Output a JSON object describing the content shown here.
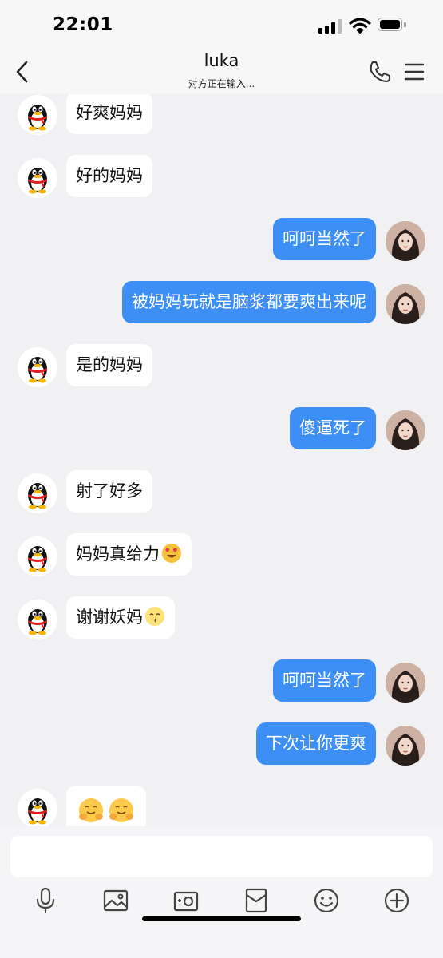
{
  "status_bar": {
    "time": "22:01"
  },
  "header": {
    "title": "luka",
    "subtitle": "对方正在输入..."
  },
  "messages": [
    {
      "side": "in",
      "text": "好爽妈妈"
    },
    {
      "side": "in",
      "text": "好的妈妈"
    },
    {
      "side": "out",
      "text": "呵呵当然了"
    },
    {
      "side": "out",
      "text": "被妈妈玩就是脑浆都要爽出来呢"
    },
    {
      "side": "in",
      "text": "是的妈妈"
    },
    {
      "side": "out",
      "text": "傻逼死了"
    },
    {
      "side": "in",
      "text": "射了好多"
    },
    {
      "side": "in",
      "text": "妈妈真给力",
      "emoji": "heart-eyes-emoji"
    },
    {
      "side": "in",
      "text": "谢谢妖妈",
      "emoji": "kissing-emoji"
    },
    {
      "side": "out",
      "text": "呵呵当然了"
    },
    {
      "side": "out",
      "text": "下次让你更爽"
    },
    {
      "side": "in",
      "text": "",
      "emoji": "shy-smile-emoji x2"
    }
  ],
  "toolbar": {
    "icons": [
      "microphone-icon",
      "photo-icon",
      "camera-icon",
      "red-packet-icon",
      "emoji-icon",
      "plus-icon"
    ]
  },
  "colors": {
    "outgoing_bubble": "#3d8ff5",
    "incoming_bubble": "#ffffff",
    "background": "#f1f1f3"
  }
}
